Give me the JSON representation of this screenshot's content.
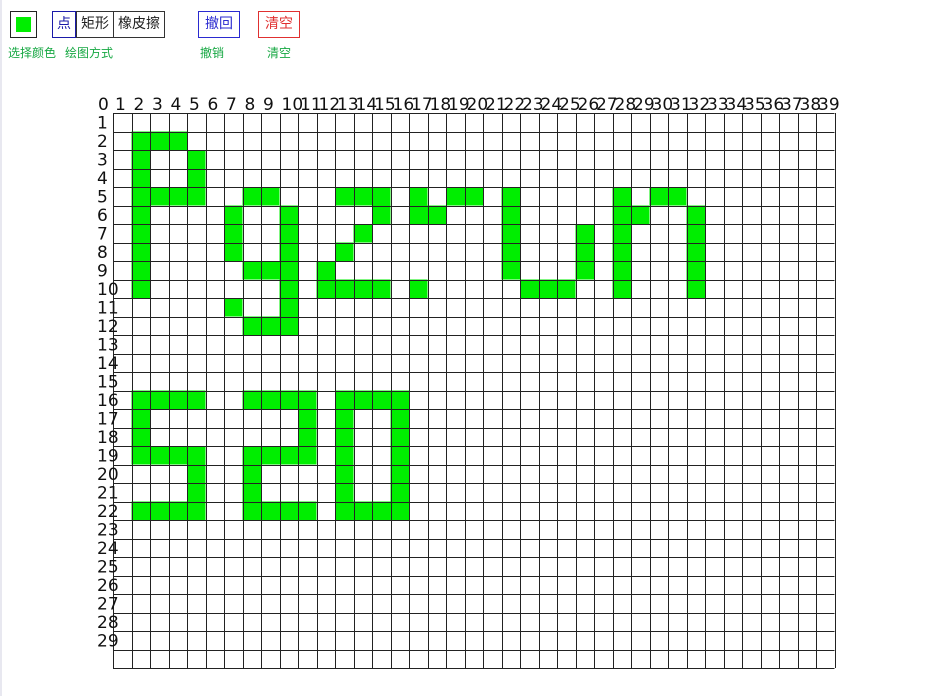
{
  "toolbar": {
    "selected_color": "#00ee00",
    "color_picker_label": "选择颜色",
    "mode_label": "绘图方式",
    "modes": [
      "点",
      "矩形",
      "橡皮擦"
    ],
    "active_mode": "点",
    "undo_label": "撤回",
    "undo_caption": "撤销",
    "clear_label": "清空",
    "clear_caption": "清空"
  },
  "grid": {
    "columns": 40,
    "rows": 30,
    "fill_color": "#00ee00",
    "col_labels": [
      "0",
      "1",
      "2",
      "3",
      "4",
      "5",
      "6",
      "7",
      "8",
      "9",
      "10",
      "11",
      "12",
      "13",
      "14",
      "15",
      "16",
      "17",
      "18",
      "19",
      "20",
      "21",
      "22",
      "23",
      "24",
      "25",
      "26",
      "27",
      "28",
      "29",
      "30",
      "31",
      "32",
      "33",
      "34",
      "35",
      "36",
      "37",
      "38",
      "39"
    ],
    "row_labels": [
      "1",
      "2",
      "3",
      "4",
      "5",
      "6",
      "7",
      "8",
      "9",
      "10",
      "11",
      "12",
      "13",
      "14",
      "15",
      "16",
      "17",
      "18",
      "19",
      "20",
      "21",
      "22",
      "23",
      "24",
      "25",
      "26",
      "27",
      "28",
      "29"
    ],
    "filled_cells": [
      [
        2,
        1
      ],
      [
        3,
        1
      ],
      [
        4,
        1
      ],
      [
        2,
        2
      ],
      [
        5,
        2
      ],
      [
        2,
        3
      ],
      [
        5,
        3
      ],
      [
        2,
        4
      ],
      [
        3,
        4
      ],
      [
        4,
        4
      ],
      [
        5,
        4
      ],
      [
        8,
        4
      ],
      [
        9,
        4
      ],
      [
        13,
        4
      ],
      [
        14,
        4
      ],
      [
        15,
        4
      ],
      [
        17,
        4
      ],
      [
        19,
        4
      ],
      [
        20,
        4
      ],
      [
        22,
        4
      ],
      [
        28,
        4
      ],
      [
        30,
        4
      ],
      [
        31,
        4
      ],
      [
        2,
        5
      ],
      [
        7,
        5
      ],
      [
        10,
        5
      ],
      [
        15,
        5
      ],
      [
        17,
        5
      ],
      [
        18,
        5
      ],
      [
        22,
        5
      ],
      [
        28,
        5
      ],
      [
        29,
        5
      ],
      [
        32,
        5
      ],
      [
        2,
        6
      ],
      [
        7,
        6
      ],
      [
        10,
        6
      ],
      [
        14,
        6
      ],
      [
        22,
        6
      ],
      [
        26,
        6
      ],
      [
        28,
        6
      ],
      [
        32,
        6
      ],
      [
        2,
        7
      ],
      [
        7,
        7
      ],
      [
        10,
        7
      ],
      [
        13,
        7
      ],
      [
        22,
        7
      ],
      [
        26,
        7
      ],
      [
        28,
        7
      ],
      [
        32,
        7
      ],
      [
        2,
        8
      ],
      [
        8,
        8
      ],
      [
        9,
        8
      ],
      [
        10,
        8
      ],
      [
        12,
        8
      ],
      [
        22,
        8
      ],
      [
        26,
        8
      ],
      [
        28,
        8
      ],
      [
        32,
        8
      ],
      [
        2,
        9
      ],
      [
        10,
        9
      ],
      [
        12,
        9
      ],
      [
        13,
        9
      ],
      [
        14,
        9
      ],
      [
        15,
        9
      ],
      [
        17,
        9
      ],
      [
        23,
        9
      ],
      [
        24,
        9
      ],
      [
        25,
        9
      ],
      [
        28,
        9
      ],
      [
        32,
        9
      ],
      [
        7,
        10
      ],
      [
        10,
        10
      ],
      [
        8,
        11
      ],
      [
        9,
        11
      ],
      [
        10,
        11
      ],
      [
        2,
        15
      ],
      [
        3,
        15
      ],
      [
        4,
        15
      ],
      [
        5,
        15
      ],
      [
        8,
        15
      ],
      [
        9,
        15
      ],
      [
        10,
        15
      ],
      [
        11,
        15
      ],
      [
        13,
        15
      ],
      [
        14,
        15
      ],
      [
        15,
        15
      ],
      [
        16,
        15
      ],
      [
        2,
        16
      ],
      [
        11,
        16
      ],
      [
        13,
        16
      ],
      [
        16,
        16
      ],
      [
        2,
        17
      ],
      [
        11,
        17
      ],
      [
        13,
        17
      ],
      [
        16,
        17
      ],
      [
        2,
        18
      ],
      [
        3,
        18
      ],
      [
        4,
        18
      ],
      [
        5,
        18
      ],
      [
        8,
        18
      ],
      [
        9,
        18
      ],
      [
        10,
        18
      ],
      [
        11,
        18
      ],
      [
        13,
        18
      ],
      [
        16,
        18
      ],
      [
        5,
        19
      ],
      [
        8,
        19
      ],
      [
        13,
        19
      ],
      [
        16,
        19
      ],
      [
        5,
        20
      ],
      [
        8,
        20
      ],
      [
        13,
        20
      ],
      [
        16,
        20
      ],
      [
        2,
        21
      ],
      [
        3,
        21
      ],
      [
        4,
        21
      ],
      [
        5,
        21
      ],
      [
        8,
        21
      ],
      [
        9,
        21
      ],
      [
        10,
        21
      ],
      [
        11,
        21
      ],
      [
        13,
        21
      ],
      [
        14,
        21
      ],
      [
        15,
        21
      ],
      [
        16,
        21
      ]
    ]
  }
}
